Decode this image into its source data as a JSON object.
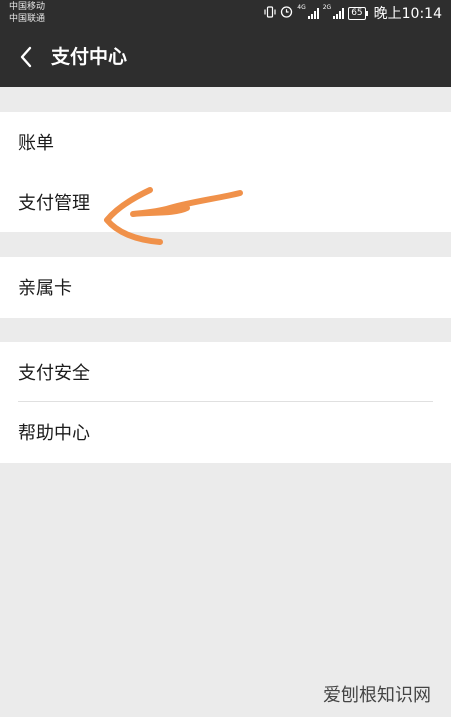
{
  "status_bar": {
    "carrier_1": "中国移动",
    "carrier_2": "中国联通",
    "net_1": "4G",
    "net_2": "2G",
    "battery": "65",
    "time": "晚上10:14"
  },
  "nav": {
    "title": "支付中心",
    "back_icon": "chevron-left-icon"
  },
  "menu": {
    "group1": [
      {
        "label": "账单"
      },
      {
        "label": "支付管理"
      }
    ],
    "group2": [
      {
        "label": "亲属卡"
      }
    ],
    "group3": [
      {
        "label": "支付安全"
      },
      {
        "label": "帮助中心"
      }
    ]
  },
  "annotation": {
    "icon": "hand-drawn-arrow",
    "color": "#f0914a"
  },
  "watermark": {
    "text": "爱刨根知识网"
  },
  "colors": {
    "header_bg": "#2e2e2e",
    "page_bg": "#ebebeb",
    "row_bg": "#ffffff"
  }
}
